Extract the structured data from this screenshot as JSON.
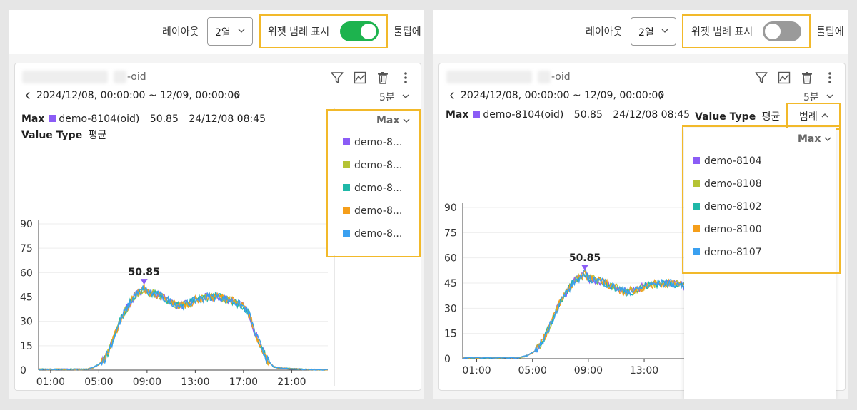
{
  "toolbar": {
    "layout_label": "레이아웃",
    "layout_value": "2열",
    "widget_legend_label": "위젯 범례 표시",
    "tooltip_label": "툴팁에"
  },
  "panels": {
    "left": {
      "widget_legend_on": true
    },
    "right": {
      "widget_legend_on": false
    }
  },
  "widget": {
    "title_suffix": "-oid",
    "date_range": "2024/12/08, 00:00:00 ~ 12/09, 00:00:00",
    "interval": "5분",
    "max_label": "Max",
    "max_item": "demo-8104(oid)",
    "max_value": "50.85",
    "max_time": "24/12/08 08:45",
    "value_type_label": "Value Type",
    "value_type": "평균",
    "legend_toggle_label": "범례"
  },
  "legend": {
    "sort_label": "Max",
    "items_full": [
      "demo-8104",
      "demo-8108",
      "demo-8102",
      "demo-8100",
      "demo-8107"
    ],
    "items_truncated": [
      "demo-8...",
      "demo-8...",
      "demo-8...",
      "demo-8...",
      "demo-8..."
    ],
    "colors": [
      "#8b5cf6",
      "#b5c334",
      "#1fb8a8",
      "#f59e1a",
      "#3aa0f0"
    ]
  },
  "chart_data": {
    "type": "line",
    "yticks": [
      "0",
      "15",
      "30",
      "45",
      "60",
      "75",
      "90"
    ],
    "ylim": [
      0,
      90
    ],
    "xticks": [
      "01:00",
      "05:00",
      "09:00",
      "13:00",
      "17:00",
      "21:00"
    ],
    "xlim_hours": [
      0,
      24
    ],
    "peak_label": "50.85",
    "peak_hour": 8.75,
    "series": [
      {
        "name": "demo-8104",
        "color": "#8b5cf6"
      },
      {
        "name": "demo-8108",
        "color": "#b5c334"
      },
      {
        "name": "demo-8102",
        "color": "#1fb8a8"
      },
      {
        "name": "demo-8100",
        "color": "#f59e1a"
      },
      {
        "name": "demo-8107",
        "color": "#3aa0f0"
      }
    ],
    "x_hours": [
      0,
      1,
      2,
      3,
      4,
      4.5,
      5,
      5.5,
      6,
      6.5,
      7,
      7.5,
      8,
      8.5,
      8.75,
      9,
      9.5,
      10,
      11,
      11.5,
      12,
      12.5,
      13,
      14,
      15,
      16,
      17,
      17.5,
      18,
      19,
      19.5,
      20,
      21,
      22,
      23,
      24
    ],
    "y_avg": [
      0.5,
      0.5,
      0.5,
      0.5,
      0.5,
      1.5,
      3.5,
      7,
      15,
      25,
      34,
      40,
      46,
      48.5,
      50.85,
      48,
      47,
      46,
      42,
      40,
      40,
      41,
      43,
      45,
      45,
      43,
      39,
      34,
      22,
      6,
      2,
      1.2,
      0.8,
      0.5,
      0.3,
      0.2
    ]
  }
}
